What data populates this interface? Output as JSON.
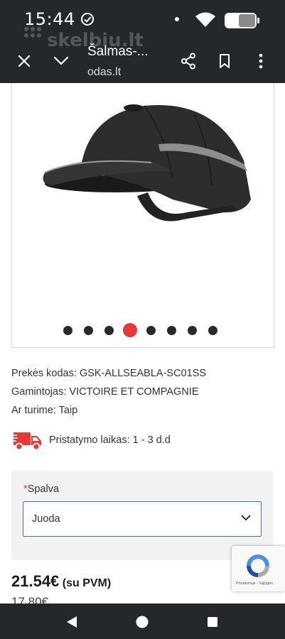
{
  "status_bar": {
    "time": "15:44"
  },
  "toolbar": {
    "title": "Šalmas-...",
    "url": "odas.lt",
    "watermark": "skelbiu.lt"
  },
  "gallery": {
    "image_alt": "black bump cap with reflective stripe",
    "total_images": 8,
    "active_index": 4
  },
  "specs": {
    "code_label": "Prekės kodas:",
    "code_value": "GSK-ALLSEABLA-SC01SS",
    "maker_label": "Gamintojas:",
    "maker_value": "VICTOIRE ET COMPAGNIE",
    "stock_label": "Ar turime:",
    "stock_value": "Taip"
  },
  "delivery": {
    "label": "Pristatymo laikas:",
    "value": "1 - 3 d.d"
  },
  "option": {
    "required_mark": "*",
    "label": "Spalva",
    "selected": "Juoda"
  },
  "price": {
    "main": "21.54€",
    "suffix": "(su PVM)",
    "old": "17.80€"
  },
  "recaptcha": {
    "text": "Privatumas - Sąlygos"
  },
  "colors": {
    "bar_bg": "#25282b",
    "accent_red": "#e53935",
    "select_border": "#3d6fd6"
  }
}
